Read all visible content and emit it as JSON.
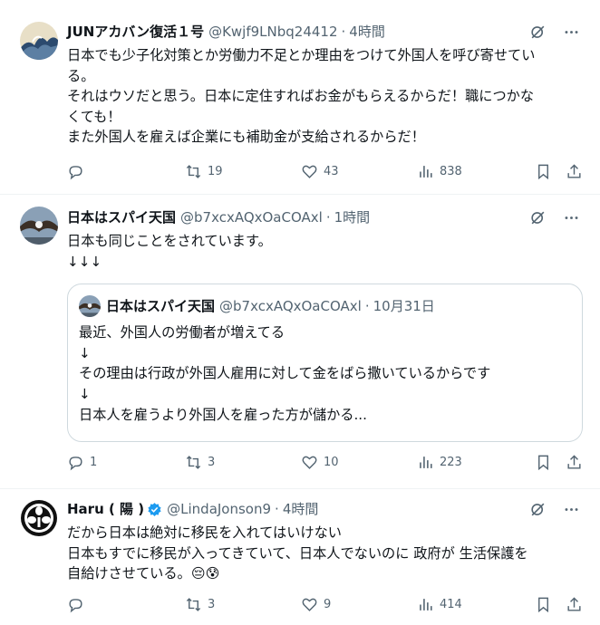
{
  "tweets": [
    {
      "display_name": "JUNアカバン復活１号",
      "handle": "@Kwjf9LNbq24412",
      "time": "4時間",
      "text_lines": [
        "日本でも少子化対策とか労働力不足とか理由をつけて外国人を呼び寄せてい",
        "る。",
        "それはウソだと思う。日本に定住すればお金がもらえるからだ！職につかな",
        "くても！",
        "また外国人を雇えば企業にも補助金が支給されるからだ！"
      ],
      "stats": {
        "replies": "",
        "reposts": "19",
        "likes": "43",
        "views": "838"
      }
    },
    {
      "display_name": "日本はスパイ天国",
      "handle": "@b7xcxAQxOaCOAxl",
      "time": "1時間",
      "text_lines": [
        "日本も同じことをされています。",
        "↓↓↓"
      ],
      "quote": {
        "display_name": "日本はスパイ天国",
        "handle": "@b7xcxAQxOaCOAxl",
        "time": "10月31日",
        "text_lines": [
          "最近、外国人の労働者が増えてる",
          "↓",
          "その理由は行政が外国人雇用に対して金をばら撒いているからです",
          "↓",
          "日本人を雇うより外国人を雇った方が儲かる..."
        ]
      },
      "stats": {
        "replies": "1",
        "reposts": "3",
        "likes": "10",
        "views": "223"
      }
    },
    {
      "display_name": "Haru ( 陽 )",
      "handle": "@LindaJonson9",
      "time": "4時間",
      "text_lines": [
        "だから日本は絶対に移民を入れてはいけない",
        "日本もすでに移民が入ってきていて、日本人でないのに 政府が 生活保護を",
        "自給けさせている。😔😰"
      ],
      "stats": {
        "replies": "",
        "reposts": "3",
        "likes": "9",
        "views": "414"
      }
    }
  ],
  "colors": {
    "text": "#0f1419",
    "secondary": "#536471",
    "border": "#eff3f4",
    "verified": "#1d9bf0"
  }
}
